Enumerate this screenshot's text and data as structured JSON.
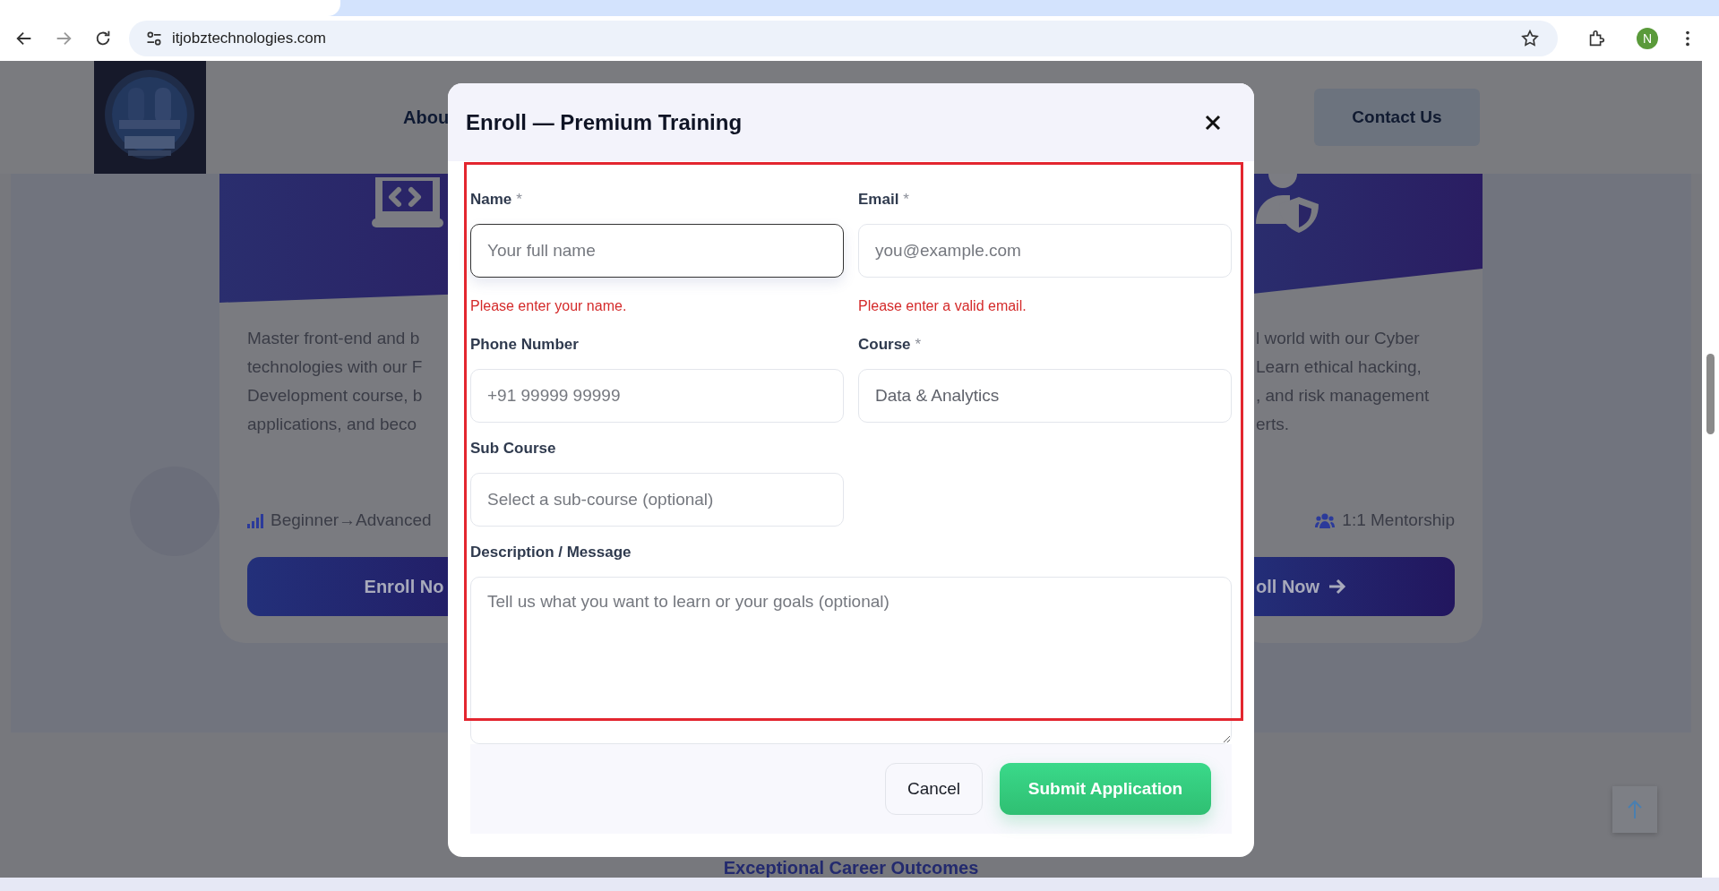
{
  "browser": {
    "url": "itjobztechnologies.com",
    "profile_initial": "N"
  },
  "site_header": {
    "nav_items": [
      {
        "label": "Abou"
      }
    ],
    "contact_button": "Contact Us"
  },
  "course_cards": [
    {
      "description_lines": [
        "Master front-end and b",
        "technologies with our F",
        "Development course, b",
        "applications, and beco"
      ],
      "meta": [
        {
          "text": "Beginner→Advanced"
        }
      ],
      "button": {
        "label": "Enroll No",
        "arrow": false
      }
    },
    {
      "description_lines": [
        "l world with our Cyber",
        "Learn ethical hacking,",
        ", and risk management",
        "erts."
      ],
      "meta": [
        {
          "text": "1:1 Mentorship"
        }
      ],
      "button": {
        "label": "oll Now",
        "arrow": true
      }
    }
  ],
  "section_heading": "Exceptional Career Outcomes",
  "modal": {
    "title": "Enroll — Premium Training",
    "fields": [
      {
        "kind": "input",
        "label": "Name",
        "required_mark": "*",
        "placeholder": "Your full name",
        "focused": true,
        "error": "Please enter your name."
      },
      {
        "kind": "input",
        "label": "Email",
        "required_mark": "*",
        "placeholder": "you@example.com",
        "focused": false,
        "error": "Please enter a valid email."
      },
      {
        "kind": "input",
        "label": "Phone Number",
        "placeholder": "+91 99999 99999",
        "focused": false
      },
      {
        "kind": "select",
        "label": "Course",
        "required_mark": "*",
        "value": "Data & Analytics",
        "focused": false
      },
      {
        "kind": "select",
        "label": "Sub Course",
        "placeholder": "Select a sub-course (optional)",
        "focused": false
      },
      {
        "kind": "textarea",
        "label": "Description / Message",
        "placeholder": "Tell us what you want to learn or your goals (optional)",
        "focused": false
      }
    ],
    "buttons": [
      {
        "kind": "secondary",
        "label": "Cancel"
      },
      {
        "kind": "primary",
        "label": "Submit Application"
      }
    ]
  },
  "annotations": [
    {
      "kind": "frame"
    }
  ]
}
